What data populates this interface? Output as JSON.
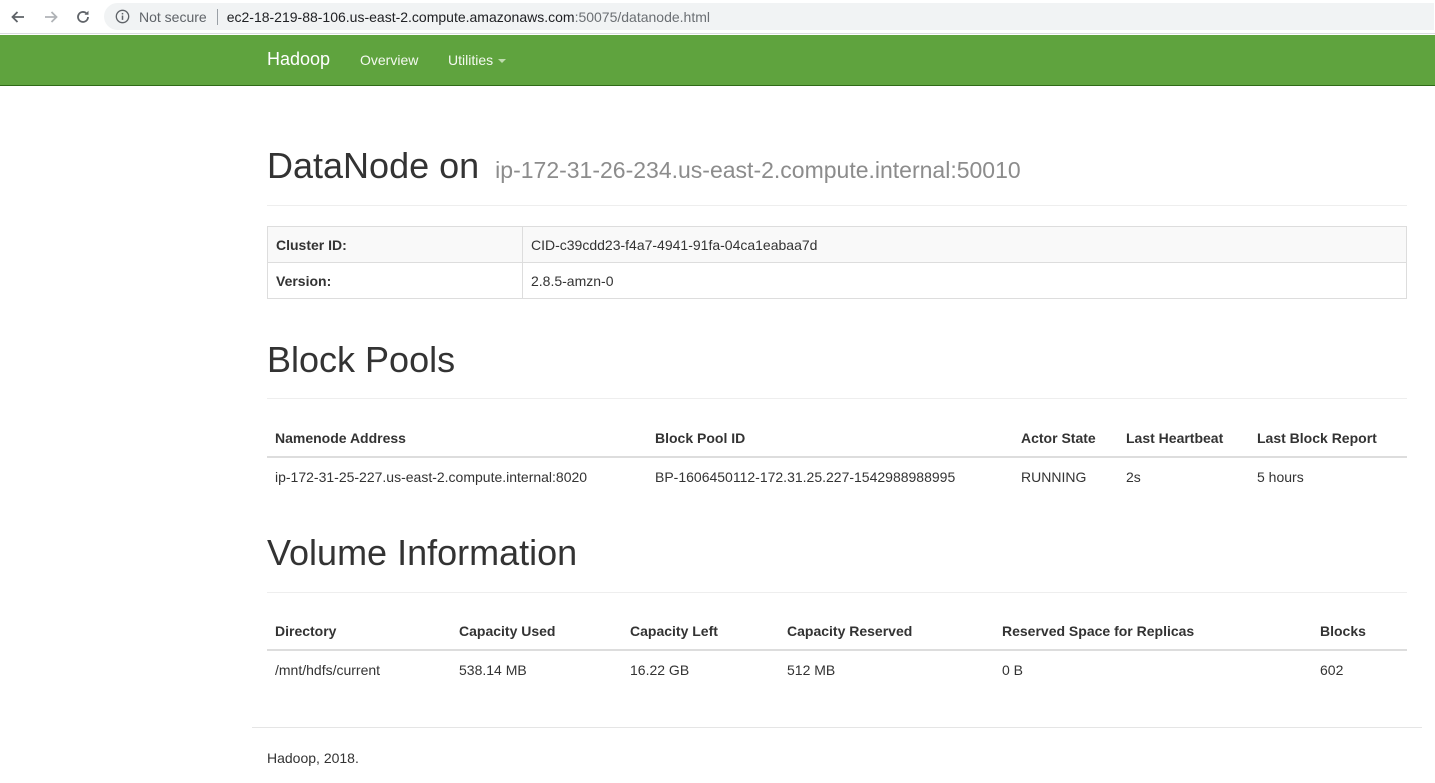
{
  "browser": {
    "security_label": "Not secure",
    "url_host": "ec2-18-219-88-106.us-east-2.compute.amazonaws.com",
    "url_rest": ":50075/datanode.html"
  },
  "navbar": {
    "brand": "Hadoop",
    "overview": "Overview",
    "utilities": "Utilities",
    "color": "#5fa33e"
  },
  "header": {
    "title": "DataNode on",
    "host": "ip-172-31-26-234.us-east-2.compute.internal:50010"
  },
  "info": [
    {
      "key": "Cluster ID:",
      "value": "CID-c39cdd23-f4a7-4941-91fa-04ca1eabaa7d"
    },
    {
      "key": "Version:",
      "value": "2.8.5-amzn-0"
    }
  ],
  "block_pools": {
    "title": "Block Pools",
    "headers": [
      "Namenode Address",
      "Block Pool ID",
      "Actor State",
      "Last Heartbeat",
      "Last Block Report"
    ],
    "rows": [
      [
        "ip-172-31-25-227.us-east-2.compute.internal:8020",
        "BP-1606450112-172.31.25.227-1542988988995",
        "RUNNING",
        "2s",
        "5 hours"
      ]
    ]
  },
  "volumes": {
    "title": "Volume Information",
    "headers": [
      "Directory",
      "Capacity Used",
      "Capacity Left",
      "Capacity Reserved",
      "Reserved Space for Replicas",
      "Blocks"
    ],
    "rows": [
      [
        "/mnt/hdfs/current",
        "538.14 MB",
        "16.22 GB",
        "512 MB",
        "0 B",
        "602"
      ]
    ]
  },
  "footer": "Hadoop, 2018."
}
